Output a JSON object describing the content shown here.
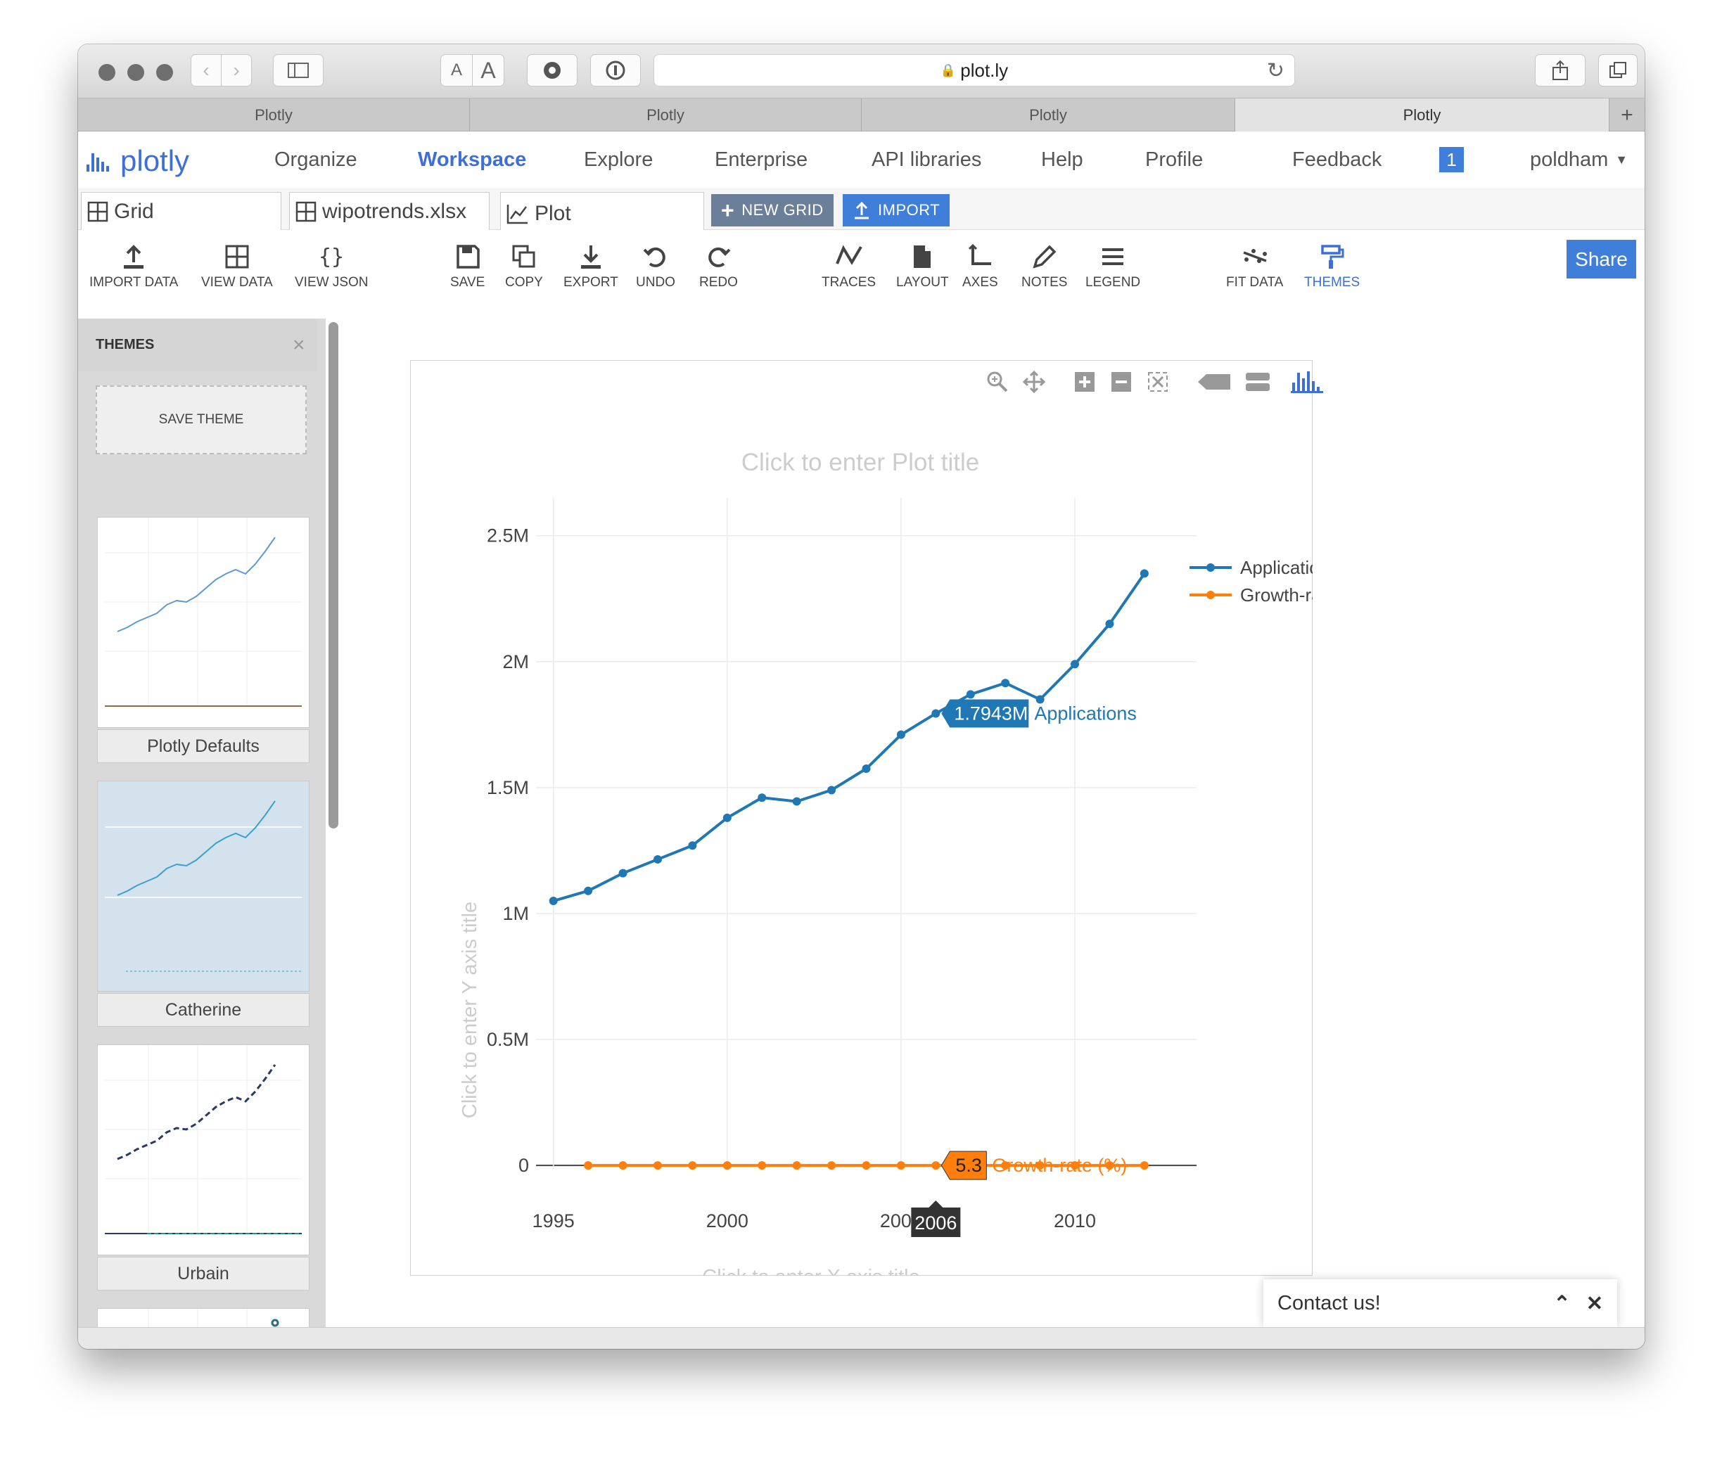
{
  "browser": {
    "url": "plot.ly",
    "reader_small": "A",
    "reader_large": "A",
    "tabs": [
      {
        "label": "Plotly"
      },
      {
        "label": "Plotly"
      },
      {
        "label": "Plotly"
      },
      {
        "label": "Plotly"
      }
    ],
    "new_tab": "+"
  },
  "nav": {
    "brand": "plotly",
    "links": [
      "Organize",
      "Workspace",
      "Explore",
      "Enterprise",
      "API libraries",
      "Help",
      "Profile",
      "Feedback"
    ],
    "active": "Workspace",
    "notification_count": "1",
    "user": "poldham"
  },
  "subtabs": {
    "tabs": [
      "Grid",
      "wipotrends.xlsx",
      "Plot"
    ],
    "new_grid": "NEW GRID",
    "import": "IMPORT"
  },
  "toolbar": {
    "items": [
      "IMPORT DATA",
      "VIEW DATA",
      "VIEW JSON",
      "SAVE",
      "COPY",
      "EXPORT",
      "UNDO",
      "REDO",
      "TRACES",
      "LAYOUT",
      "AXES",
      "NOTES",
      "LEGEND",
      "FIT DATA",
      "THEMES"
    ],
    "active": "THEMES",
    "share": "Share"
  },
  "sidebar": {
    "title": "THEMES",
    "save_theme": "SAVE THEME",
    "themes": [
      "Plotly Defaults",
      "Catherine",
      "Urbain"
    ]
  },
  "plot": {
    "title_placeholder": "Click to enter Plot title",
    "x_title_placeholder": "Click to enter X axis title",
    "y_title_placeholder": "Click to enter Y axis title",
    "hover_applications_value": "1.7943M",
    "hover_applications_label": "Applications",
    "hover_growth_value": "5.3",
    "hover_growth_label": "Growth-rate (%)",
    "hover_x": "2006"
  },
  "chart_data": {
    "type": "line",
    "title": "",
    "xlabel": "",
    "ylabel": "",
    "x": [
      1995,
      1996,
      1997,
      1998,
      1999,
      2000,
      2001,
      2002,
      2003,
      2004,
      2005,
      2006,
      2007,
      2008,
      2009,
      2010,
      2011,
      2012,
      2013
    ],
    "series": [
      {
        "name": "Applications",
        "color": "#1f77b4",
        "values": [
          1050000,
          1090000,
          1160000,
          1215000,
          1270000,
          1380000,
          1460000,
          1445000,
          1490000,
          1575000,
          1710000,
          1794300,
          1870000,
          1915000,
          1850000,
          1990000,
          2150000,
          2350000,
          null
        ]
      },
      {
        "name": "Growth-rate (%)",
        "color": "#ff7f0e",
        "values": [
          null,
          5,
          6,
          5,
          4,
          9,
          6,
          -1,
          3,
          6,
          8,
          5.3,
          4,
          2,
          -3,
          7,
          8,
          9,
          null
        ]
      }
    ],
    "xlim": [
      1994.5,
      2013.5
    ],
    "ylim": [
      -50000,
      2650000
    ],
    "x_ticks": [
      1995,
      2000,
      2005,
      2010
    ],
    "x_tick_labels": [
      "1995",
      "2000",
      "2005",
      "2010"
    ],
    "y_ticks": [
      0,
      500000,
      1000000,
      1500000,
      2000000,
      2500000
    ],
    "y_tick_labels": [
      "0",
      "0.5M",
      "1M",
      "1.5M",
      "2M",
      "2.5M"
    ],
    "grid": true,
    "legend_position": "top-right"
  },
  "contact": {
    "label": "Contact us!"
  }
}
